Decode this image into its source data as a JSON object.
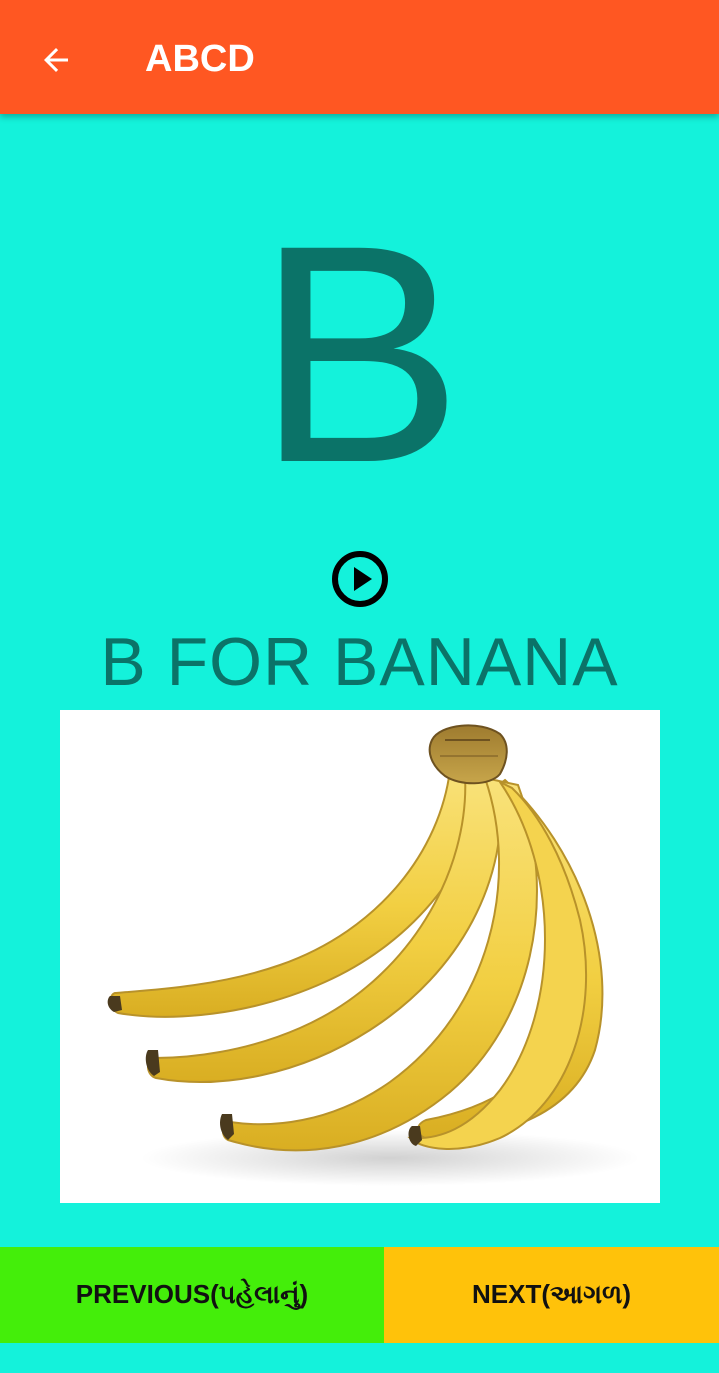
{
  "app_bar": {
    "title": "ABCD",
    "back_icon": "arrow-left-icon",
    "color": "#FF5722"
  },
  "lesson": {
    "letter": "B",
    "word_title": "B FOR BANANA",
    "play_icon": "play-circle-icon",
    "image_subject": "banana-bunch-image"
  },
  "navigation": {
    "previous_label": "PREVIOUS(પહેલાનું)",
    "next_label": "NEXT(આગળ)",
    "previous_color": "#44EE0A",
    "next_color": "#FFC20A"
  },
  "colors": {
    "background": "#14F2DB",
    "accent_text": "#0B7368"
  }
}
